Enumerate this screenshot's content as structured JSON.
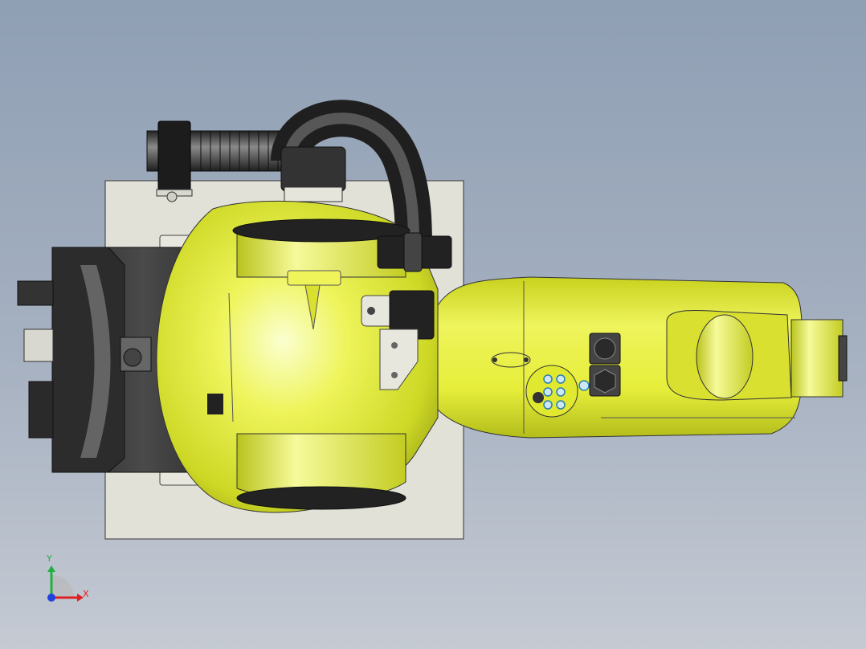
{
  "view": {
    "background_top": "#8f9fb4",
    "background_bottom": "#c5cad3"
  },
  "model": {
    "body_color": "#e6ee3a",
    "body_shadow": "#9fa81a",
    "base_plate_color": "#e2e1d8",
    "motor_color": "#3c3c3c",
    "cable_color": "#2e2e2e"
  },
  "triad": {
    "x_label": "X",
    "y_label": "Y",
    "x_color": "#e02020",
    "y_color": "#20b040",
    "z_color": "#2040e0"
  }
}
